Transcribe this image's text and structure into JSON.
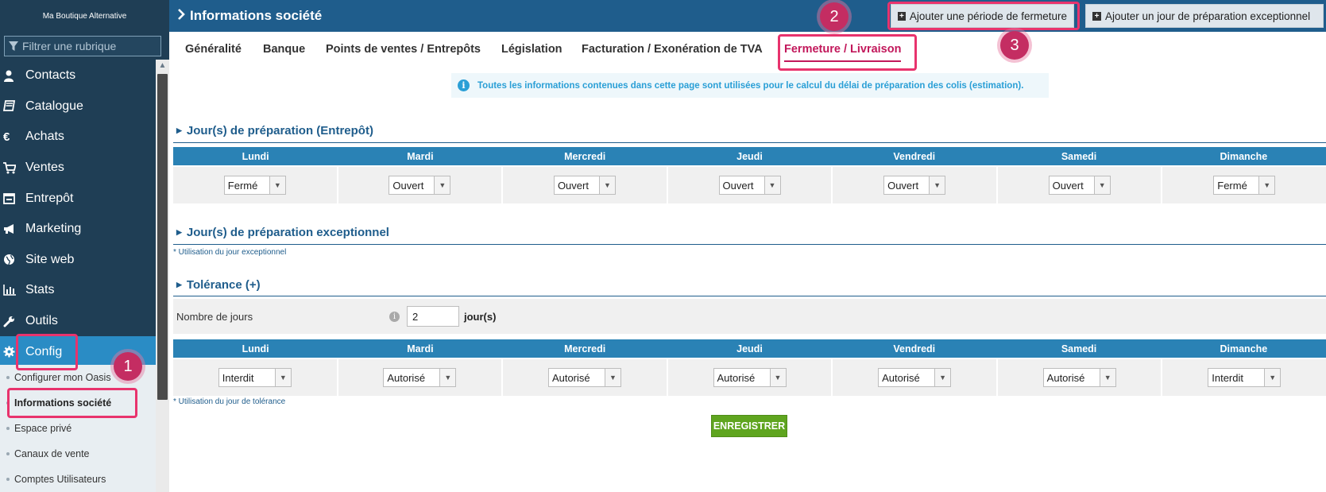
{
  "brand": "Ma Boutique Alternative",
  "filter": {
    "placeholder": "Filtrer une rubrique",
    "icon": "filter-icon"
  },
  "sidebar": {
    "items": [
      {
        "label": "Contacts",
        "icon": "user-icon"
      },
      {
        "label": "Catalogue",
        "icon": "book-icon"
      },
      {
        "label": "Achats",
        "icon": "euro-icon"
      },
      {
        "label": "Ventes",
        "icon": "cart-icon"
      },
      {
        "label": "Entrepôt",
        "icon": "warehouse-icon"
      },
      {
        "label": "Marketing",
        "icon": "megaphone-icon"
      },
      {
        "label": "Site web",
        "icon": "globe-icon"
      },
      {
        "label": "Stats",
        "icon": "bar-chart-icon"
      },
      {
        "label": "Outils",
        "icon": "wrench-icon"
      },
      {
        "label": "Config",
        "icon": "gear-icon",
        "active": true
      }
    ],
    "sub_items": [
      {
        "label": "Configurer mon Oasis"
      },
      {
        "label": "Informations société",
        "current": true
      },
      {
        "label": "Espace privé"
      },
      {
        "label": "Canaux de vente"
      },
      {
        "label": "Comptes Utilisateurs"
      }
    ]
  },
  "header": {
    "title": "Informations société",
    "btn_add_period": "Ajouter une période de fermeture",
    "btn_add_day": "Ajouter un jour de préparation exceptionnel"
  },
  "tabs": [
    {
      "label": "Généralité"
    },
    {
      "label": "Banque"
    },
    {
      "label": "Points de ventes / Entrepôts"
    },
    {
      "label": "Législation"
    },
    {
      "label": "Facturation / Exonération de TVA"
    },
    {
      "label": "Fermeture / Livraison",
      "active": true
    }
  ],
  "info_message": "Toutes les informations contenues dans cette page sont utilisées pour le calcul du délai de préparation des colis (estimation).",
  "days": [
    "Lundi",
    "Mardi",
    "Mercredi",
    "Jeudi",
    "Vendredi",
    "Samedi",
    "Dimanche"
  ],
  "section_preparation": {
    "title": "Jour(s) de préparation (Entrepôt)",
    "values": [
      "Fermé",
      "Ouvert",
      "Ouvert",
      "Ouvert",
      "Ouvert",
      "Ouvert",
      "Fermé"
    ]
  },
  "section_exceptional": {
    "title": "Jour(s) de préparation exceptionnel",
    "note": "* Utilisation du jour exceptionnel"
  },
  "section_tolerance": {
    "title": "Tolérance (+)",
    "days_label": "Nombre de jours",
    "days_value": "2",
    "days_unit": "jour(s)",
    "values": [
      "Interdit",
      "Autorisé",
      "Autorisé",
      "Autorisé",
      "Autorisé",
      "Autorisé",
      "Interdit"
    ],
    "note": "* Utilisation du jour de tolérance"
  },
  "save_label": "ENREGISTRER",
  "annotations": [
    "1",
    "2",
    "3"
  ],
  "colors": {
    "sidebar": "#1f3e55",
    "header": "#1f5d8c",
    "accent": "#2a82b5",
    "active_tab": "#c2185b",
    "highlight": "#e8336d",
    "save": "#5fa51f"
  }
}
